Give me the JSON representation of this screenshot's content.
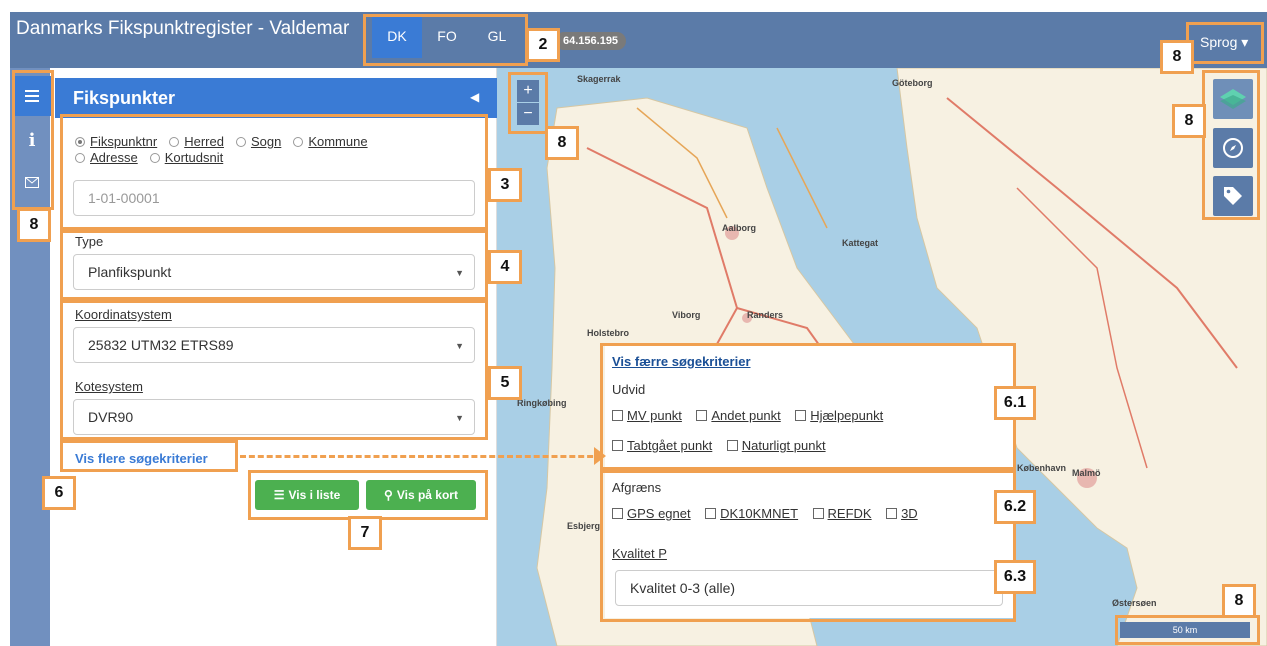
{
  "navbar": {
    "title": "Danmarks Fikspunktregister - Valdemar",
    "languages": [
      "DK",
      "FO",
      "GL"
    ],
    "active_language": "DK",
    "ip": "64.156.195",
    "sprog": "Sprog ▾"
  },
  "panel": {
    "title": "Fikspunkter",
    "search_modes": [
      "Fikspunktnr",
      "Herred",
      "Sogn",
      "Kommune",
      "Adresse",
      "Kortudsnit"
    ],
    "selected_mode": "Fikspunktnr",
    "search_placeholder": "1-01-00001",
    "type_label": "Type",
    "type_value": "Planfikspunkt",
    "koordinat_label": "Koordinatsystem",
    "koordinat_value": "25832 UTM32 ETRS89",
    "kote_label": "Kotesystem",
    "kote_value": "DVR90",
    "more_link": "Vis flere søgekriterier",
    "btn_list": "Vis i liste",
    "btn_map": "Vis på kort"
  },
  "overlay": {
    "less_link": "Vis færre søgekriterier",
    "udvid_label": "Udvid",
    "udvid_options": [
      "MV punkt",
      "Andet punkt",
      "Hjælpepunkt",
      "Tabtgået punkt",
      "Naturligt punkt"
    ],
    "afgraens_label": "Afgræns",
    "afgraens_options": [
      "GPS egnet",
      "DK10KMNET",
      "REFDK",
      "3D"
    ],
    "kvalitet_label": "Kvalitet P",
    "kvalitet_value": "Kvalitet 0-3 (alle)"
  },
  "map": {
    "labels": [
      "Skagerrak",
      "Göteborg",
      "Aalborg",
      "Randers",
      "Kattegat",
      "Viborg",
      "Holstebro",
      "Ringkøbing",
      "Esbjerg",
      "Malmö",
      "København",
      "Østersøen"
    ],
    "scale": "50 km"
  },
  "callouts": [
    "2",
    "3",
    "4",
    "5",
    "6",
    "6.1",
    "6.2",
    "6.3",
    "7",
    "8"
  ],
  "colors": {
    "navbar": "#5b7ba8",
    "accent": "#3a7bd5",
    "callout": "#f0a050",
    "green": "#4cb050"
  }
}
